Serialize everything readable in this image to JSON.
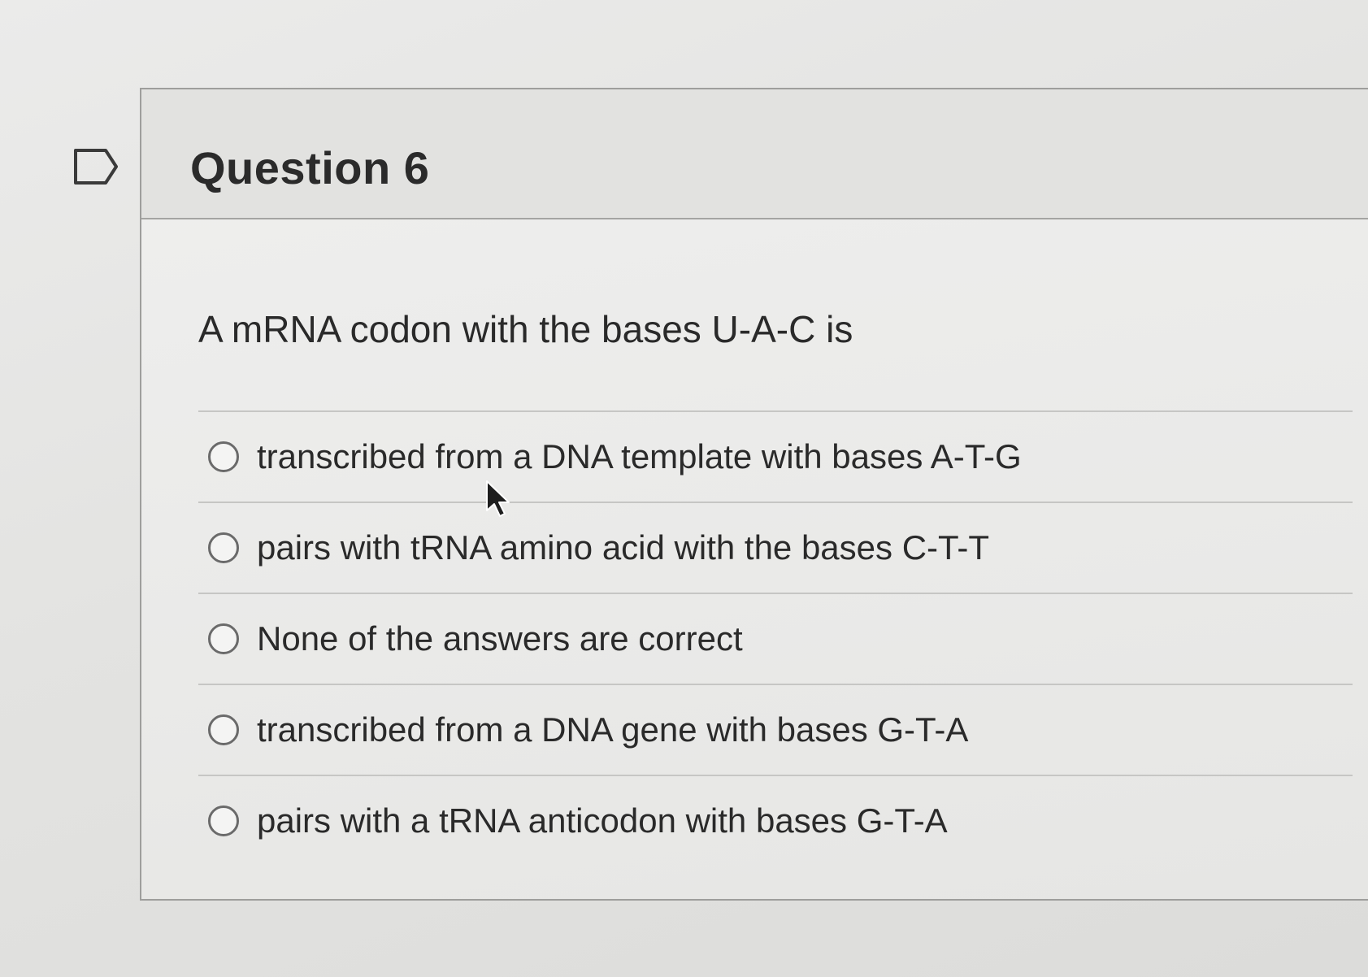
{
  "question": {
    "title": "Question 6",
    "prompt": "A mRNA codon with the bases U-A-C is",
    "flag_icon": "flag-outline-icon",
    "answers": [
      {
        "label": "transcribed from a DNA template with bases A-T-G",
        "selected": false
      },
      {
        "label": "pairs with tRNA amino acid with the bases C-T-T",
        "selected": false
      },
      {
        "label": "None of the answers are correct",
        "selected": false
      },
      {
        "label": "transcribed from a DNA gene with bases G-T-A",
        "selected": false
      },
      {
        "label": "pairs with a tRNA anticodon with bases G-T-A",
        "selected": false
      }
    ]
  },
  "colors": {
    "background": "#e4e4e2",
    "border": "#9e9e9c",
    "text": "#2a2a2a"
  }
}
